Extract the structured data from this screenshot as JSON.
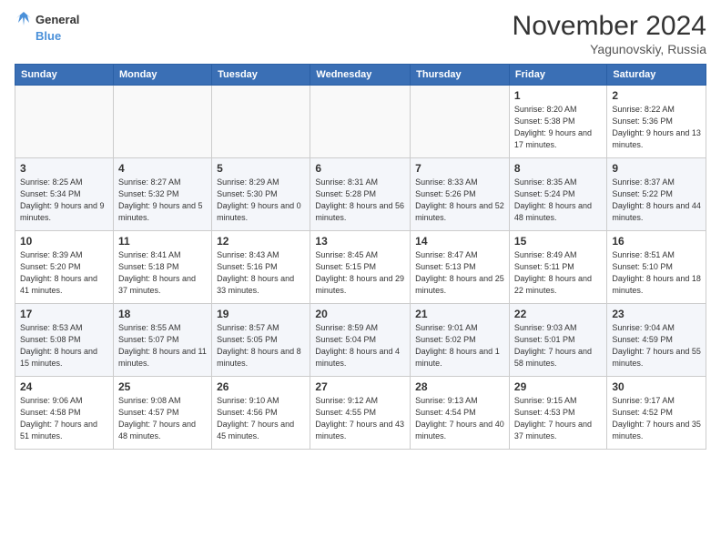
{
  "header": {
    "logo_line1": "General",
    "logo_line2": "Blue",
    "month": "November 2024",
    "location": "Yagunovskiy, Russia"
  },
  "columns": [
    "Sunday",
    "Monday",
    "Tuesday",
    "Wednesday",
    "Thursday",
    "Friday",
    "Saturday"
  ],
  "weeks": [
    [
      {
        "day": "",
        "info": ""
      },
      {
        "day": "",
        "info": ""
      },
      {
        "day": "",
        "info": ""
      },
      {
        "day": "",
        "info": ""
      },
      {
        "day": "",
        "info": ""
      },
      {
        "day": "1",
        "info": "Sunrise: 8:20 AM\nSunset: 5:38 PM\nDaylight: 9 hours and 17 minutes."
      },
      {
        "day": "2",
        "info": "Sunrise: 8:22 AM\nSunset: 5:36 PM\nDaylight: 9 hours and 13 minutes."
      }
    ],
    [
      {
        "day": "3",
        "info": "Sunrise: 8:25 AM\nSunset: 5:34 PM\nDaylight: 9 hours and 9 minutes."
      },
      {
        "day": "4",
        "info": "Sunrise: 8:27 AM\nSunset: 5:32 PM\nDaylight: 9 hours and 5 minutes."
      },
      {
        "day": "5",
        "info": "Sunrise: 8:29 AM\nSunset: 5:30 PM\nDaylight: 9 hours and 0 minutes."
      },
      {
        "day": "6",
        "info": "Sunrise: 8:31 AM\nSunset: 5:28 PM\nDaylight: 8 hours and 56 minutes."
      },
      {
        "day": "7",
        "info": "Sunrise: 8:33 AM\nSunset: 5:26 PM\nDaylight: 8 hours and 52 minutes."
      },
      {
        "day": "8",
        "info": "Sunrise: 8:35 AM\nSunset: 5:24 PM\nDaylight: 8 hours and 48 minutes."
      },
      {
        "day": "9",
        "info": "Sunrise: 8:37 AM\nSunset: 5:22 PM\nDaylight: 8 hours and 44 minutes."
      }
    ],
    [
      {
        "day": "10",
        "info": "Sunrise: 8:39 AM\nSunset: 5:20 PM\nDaylight: 8 hours and 41 minutes."
      },
      {
        "day": "11",
        "info": "Sunrise: 8:41 AM\nSunset: 5:18 PM\nDaylight: 8 hours and 37 minutes."
      },
      {
        "day": "12",
        "info": "Sunrise: 8:43 AM\nSunset: 5:16 PM\nDaylight: 8 hours and 33 minutes."
      },
      {
        "day": "13",
        "info": "Sunrise: 8:45 AM\nSunset: 5:15 PM\nDaylight: 8 hours and 29 minutes."
      },
      {
        "day": "14",
        "info": "Sunrise: 8:47 AM\nSunset: 5:13 PM\nDaylight: 8 hours and 25 minutes."
      },
      {
        "day": "15",
        "info": "Sunrise: 8:49 AM\nSunset: 5:11 PM\nDaylight: 8 hours and 22 minutes."
      },
      {
        "day": "16",
        "info": "Sunrise: 8:51 AM\nSunset: 5:10 PM\nDaylight: 8 hours and 18 minutes."
      }
    ],
    [
      {
        "day": "17",
        "info": "Sunrise: 8:53 AM\nSunset: 5:08 PM\nDaylight: 8 hours and 15 minutes."
      },
      {
        "day": "18",
        "info": "Sunrise: 8:55 AM\nSunset: 5:07 PM\nDaylight: 8 hours and 11 minutes."
      },
      {
        "day": "19",
        "info": "Sunrise: 8:57 AM\nSunset: 5:05 PM\nDaylight: 8 hours and 8 minutes."
      },
      {
        "day": "20",
        "info": "Sunrise: 8:59 AM\nSunset: 5:04 PM\nDaylight: 8 hours and 4 minutes."
      },
      {
        "day": "21",
        "info": "Sunrise: 9:01 AM\nSunset: 5:02 PM\nDaylight: 8 hours and 1 minute."
      },
      {
        "day": "22",
        "info": "Sunrise: 9:03 AM\nSunset: 5:01 PM\nDaylight: 7 hours and 58 minutes."
      },
      {
        "day": "23",
        "info": "Sunrise: 9:04 AM\nSunset: 4:59 PM\nDaylight: 7 hours and 55 minutes."
      }
    ],
    [
      {
        "day": "24",
        "info": "Sunrise: 9:06 AM\nSunset: 4:58 PM\nDaylight: 7 hours and 51 minutes."
      },
      {
        "day": "25",
        "info": "Sunrise: 9:08 AM\nSunset: 4:57 PM\nDaylight: 7 hours and 48 minutes."
      },
      {
        "day": "26",
        "info": "Sunrise: 9:10 AM\nSunset: 4:56 PM\nDaylight: 7 hours and 45 minutes."
      },
      {
        "day": "27",
        "info": "Sunrise: 9:12 AM\nSunset: 4:55 PM\nDaylight: 7 hours and 43 minutes."
      },
      {
        "day": "28",
        "info": "Sunrise: 9:13 AM\nSunset: 4:54 PM\nDaylight: 7 hours and 40 minutes."
      },
      {
        "day": "29",
        "info": "Sunrise: 9:15 AM\nSunset: 4:53 PM\nDaylight: 7 hours and 37 minutes."
      },
      {
        "day": "30",
        "info": "Sunrise: 9:17 AM\nSunset: 4:52 PM\nDaylight: 7 hours and 35 minutes."
      }
    ]
  ]
}
